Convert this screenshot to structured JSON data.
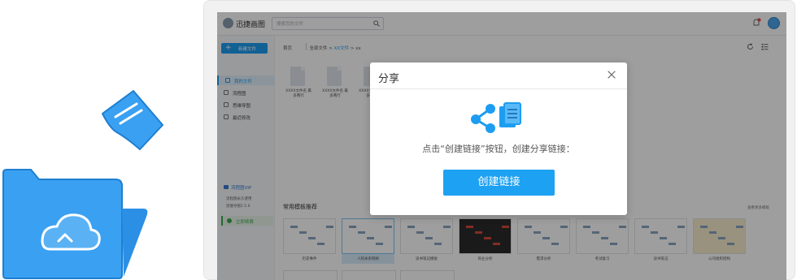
{
  "app": {
    "name": "迅捷画图",
    "search_placeholder": "搜索您的文件"
  },
  "sidebar": {
    "new_button": "新建文件",
    "items": [
      {
        "label": "我的文件",
        "active": true
      },
      {
        "label": "流程图",
        "active": false
      },
      {
        "label": "思维导图",
        "active": false
      },
      {
        "label": "最近修改",
        "active": false
      }
    ],
    "vip_label": "流程图VIP",
    "small_lines": [
      "流程图永久使用",
      "思维导图1.5.0"
    ],
    "join_label": "立即续费"
  },
  "main": {
    "breadcrumb_home": "首页",
    "breadcrumb_path_prefix": "全部文件 > ",
    "breadcrumb_link": "XX文件",
    "breadcrumb_path_suffix": " > xx",
    "files": [
      {
        "name": "XXXX文件名 最多两行"
      },
      {
        "name": "XXXX文件名 最多两行"
      },
      {
        "name": "XXXX文件名 最多两行"
      }
    ],
    "templates_title": "常用模板推荐",
    "templates_more": "查看更多模板",
    "templates": [
      {
        "caption": "历史事件",
        "selected": false,
        "style": "light"
      },
      {
        "caption": "人际关系网络",
        "selected": true,
        "style": "light"
      },
      {
        "caption": "读书笔记模板",
        "selected": false,
        "style": "light"
      },
      {
        "caption": "商业分析",
        "selected": false,
        "style": "dark"
      },
      {
        "caption": "需求分析",
        "selected": false,
        "style": "light"
      },
      {
        "caption": "考试复习",
        "selected": false,
        "style": "light"
      },
      {
        "caption": "读书笔记",
        "selected": false,
        "style": "light"
      },
      {
        "caption": "公司组织结构",
        "selected": false,
        "style": "beige"
      }
    ]
  },
  "dialog": {
    "title": "分享",
    "message": "点击“创建链接”按钮，创建分享链接：",
    "button": "创建链接",
    "close_icon": "close-icon",
    "share_icon": "share-link-icon"
  },
  "colors": {
    "accent": "#1d9df1",
    "folder": "#3aa0f2",
    "join": "#3ba94a"
  }
}
